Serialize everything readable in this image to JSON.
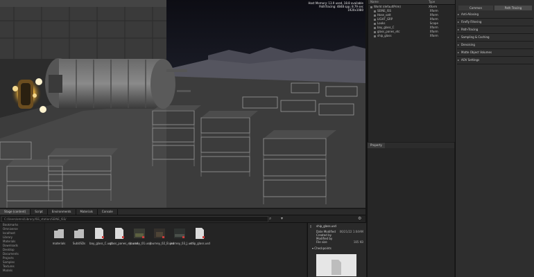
{
  "viewport": {
    "hud_lines": [
      "Host Memory: 13.9 used, 18.8 available",
      "PathTracing: 4848 spp; 8.79 sec",
      "1920x1080"
    ]
  },
  "stage": {
    "columns": {
      "name": "Name",
      "type": "Type"
    },
    "items": [
      {
        "name": "World (defaultPrim)",
        "type": "Xform"
      },
      {
        "name": "SEINE_ISS",
        "type": "Xform"
      },
      {
        "name": "Hose_satt",
        "type": "Xform"
      },
      {
        "name": "LIGHT_GRP",
        "type": "Xform"
      },
      {
        "name": "Looks",
        "type": "Scope"
      },
      {
        "name": "bay_glass_C",
        "type": "Xform"
      },
      {
        "name": "glass_panes_etc",
        "type": "Xform"
      },
      {
        "name": "ship_glass",
        "type": "Xform"
      }
    ]
  },
  "property": {
    "tab": "Property"
  },
  "settings": {
    "tabs": [
      "Common",
      "Path Tracing"
    ],
    "sections": [
      "Anti-Aliasing",
      "Firefly Filtering",
      "Path-Tracing",
      "Sampling & Caching",
      "Denoising",
      "Matte Object Volumes",
      "AOV Settings"
    ]
  },
  "bottom_tabs": [
    "Stage (content)",
    "Script",
    "Environments",
    "Materials",
    "Console"
  ],
  "pathbar": {
    "value": "C:/Users/omni/Library/ISS_station/SEINE_ISS/"
  },
  "tree": {
    "items": [
      "Bookmarks",
      "Omniverse",
      "localhost",
      "Library",
      "Materials",
      "Downloads",
      "Desktop",
      "Documents",
      "Projects",
      "Samples",
      "Textures",
      "Models"
    ]
  },
  "files": [
    {
      "name": "materials",
      "kind": "folder"
    },
    {
      "name": "SubUSDs",
      "kind": "folder"
    },
    {
      "name": "bay_glass_C.usd",
      "kind": "file"
    },
    {
      "name": "glass_panes_etc.usd",
      "kind": "file"
    },
    {
      "name": "journey_01.usd",
      "kind": "image"
    },
    {
      "name": "journey_02_B.usd",
      "kind": "image"
    },
    {
      "name": "journey_03_J.usd",
      "kind": "image"
    },
    {
      "name": "ship_glass.usd",
      "kind": "file"
    }
  ],
  "details": {
    "filename": "ship_glass.usd",
    "rows": [
      {
        "label": "Date Modified",
        "value": "06/21/22 1:04AM"
      },
      {
        "label": "Created by",
        "value": ""
      },
      {
        "label": "Modified by",
        "value": ""
      },
      {
        "label": "File size",
        "value": "185 KB"
      }
    ],
    "checkpoints": "Checkpoints"
  },
  "colors": {
    "accent": "#c9a34a",
    "background": "#1c1c1c",
    "panel": "#2e2e2e"
  }
}
